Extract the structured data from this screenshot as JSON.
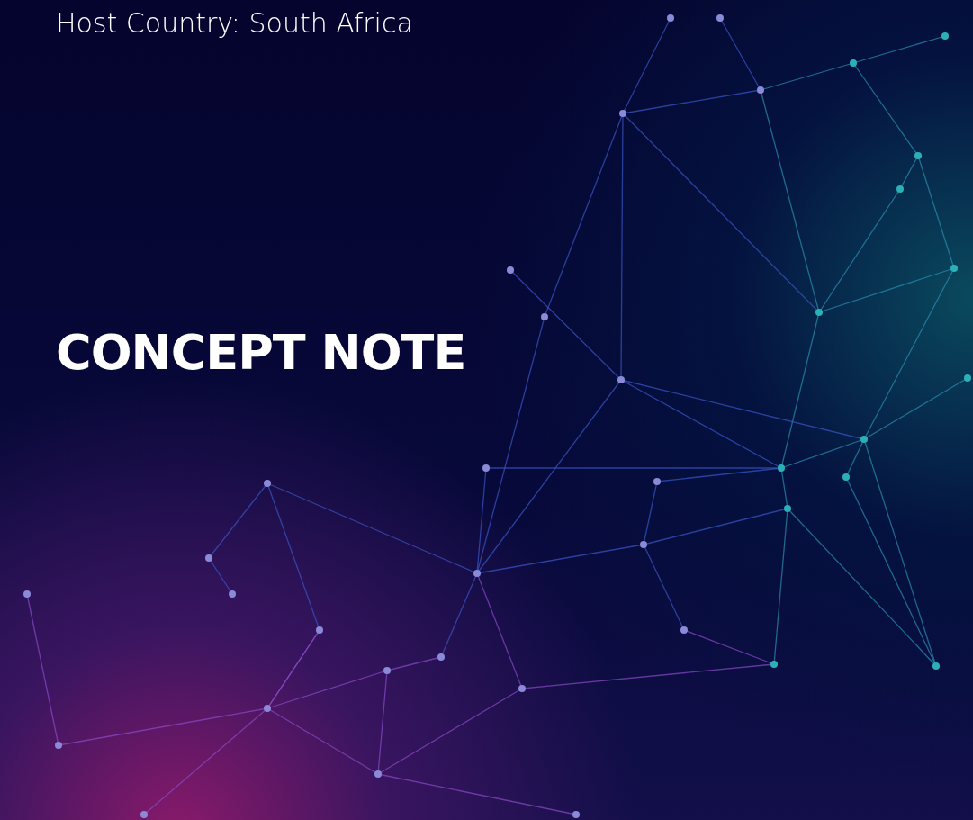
{
  "hero": {
    "subtitle": "Host Country: South Africa",
    "title": "CONCEPT NOTE"
  }
}
